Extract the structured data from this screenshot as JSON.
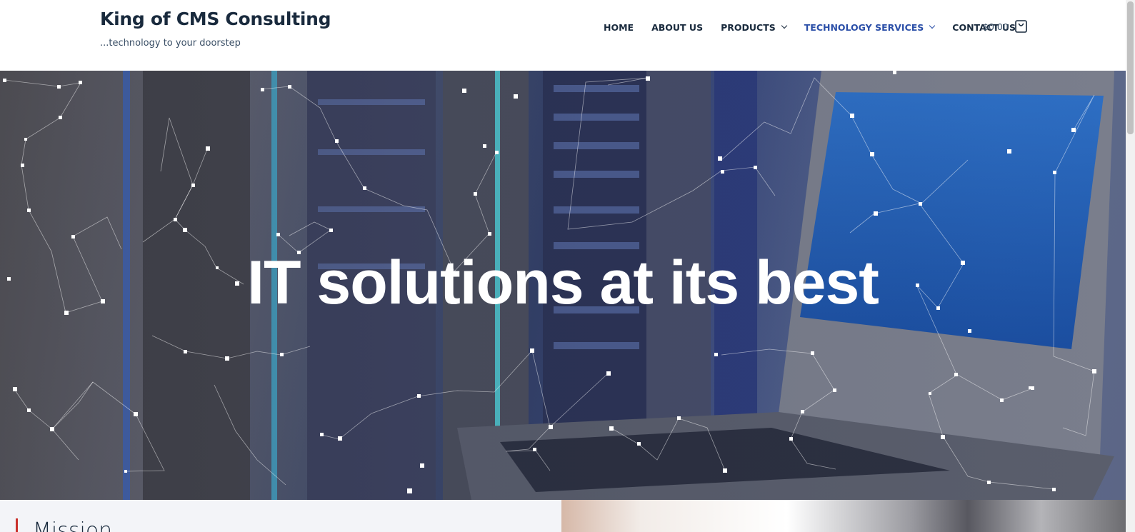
{
  "header": {
    "site_title": "King of CMS Consulting",
    "tagline": "...technology to your doorstep"
  },
  "nav": {
    "items": [
      {
        "label": "HOME",
        "has_dropdown": false,
        "active": false
      },
      {
        "label": "ABOUT US",
        "has_dropdown": false,
        "active": false
      },
      {
        "label": "PRODUCTS",
        "has_dropdown": true,
        "active": false
      },
      {
        "label": "TECHNOLOGY SERVICES",
        "has_dropdown": true,
        "active": true
      },
      {
        "label": "CONTACT US",
        "has_dropdown": false,
        "active": false
      }
    ]
  },
  "cart": {
    "price": "$0.00",
    "icon": "shopping-bag-icon"
  },
  "hero": {
    "title": "IT solutions at its best"
  },
  "sections": {
    "mission_title": "Mission"
  },
  "colors": {
    "title_text": "#192a3d",
    "active_nav": "#2b4fa8",
    "accent_bar": "#c9302c"
  }
}
